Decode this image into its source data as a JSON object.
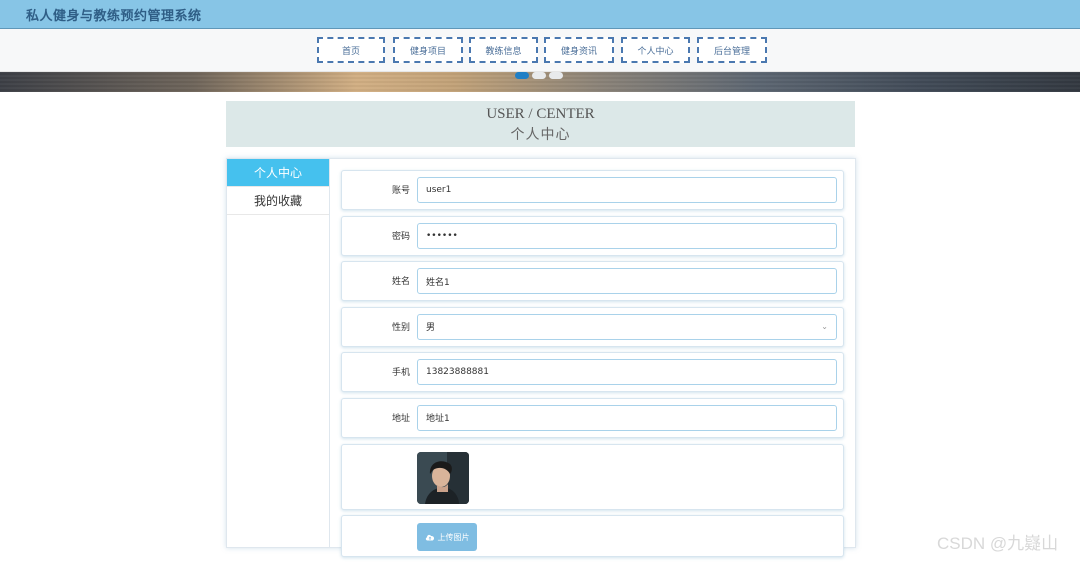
{
  "app": {
    "title": "私人健身与教练预约管理系统"
  },
  "nav": {
    "items": [
      {
        "label": "首页"
      },
      {
        "label": "健身项目"
      },
      {
        "label": "教练信息"
      },
      {
        "label": "健身资讯"
      },
      {
        "label": "个人中心"
      },
      {
        "label": "后台管理"
      }
    ]
  },
  "carousel": {
    "slide_count": 3,
    "active_index": 0
  },
  "heading": {
    "en": "USER / CENTER",
    "zh": "个人中心"
  },
  "sidebar": {
    "items": [
      {
        "label": "个人中心",
        "active": true
      },
      {
        "label": "我的收藏",
        "active": false
      }
    ]
  },
  "form": {
    "account": {
      "label": "账号",
      "value": "user1"
    },
    "password": {
      "label": "密码",
      "value": "••••••"
    },
    "name": {
      "label": "姓名",
      "value": "姓名1"
    },
    "gender": {
      "label": "性别",
      "value": "男",
      "arrow": "⌄"
    },
    "phone": {
      "label": "手机",
      "value": "13823888881"
    },
    "address": {
      "label": "地址",
      "value": "地址1"
    },
    "upload": {
      "label": "上传图片",
      "icon": "cloud-upload-icon"
    }
  },
  "watermark": {
    "text": "CSDN @九嶷山"
  },
  "colors": {
    "topbar": "#87c5e6",
    "nav_border": "#4a78b0",
    "sidebar_active": "#45c1ee",
    "upload_button": "#7fbde2",
    "carousel_active_dot": "#1f7fc6"
  }
}
